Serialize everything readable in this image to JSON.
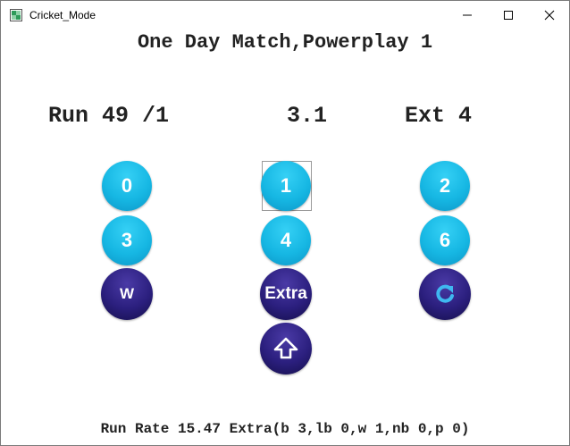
{
  "window": {
    "title": "Cricket_Mode"
  },
  "heading": "One Day Match,Powerplay 1",
  "score": {
    "runs": "Run 49 /1",
    "overs": "3.1",
    "extras": "Ext 4"
  },
  "buttons": {
    "run_0": "0",
    "run_1": "1",
    "run_2": "2",
    "run_3": "3",
    "run_4": "4",
    "run_6": "6",
    "wicket": "W",
    "extra": "Extra"
  },
  "icons": {
    "undo": "refresh-icon",
    "home": "home-up-arrow-icon"
  },
  "footer": "Run Rate 15.47 Extra(b 3,lb 0,w 1,nb 0,p 0)",
  "colors": {
    "run_button": "#16b7e3",
    "action_button": "#2b1f7e"
  }
}
